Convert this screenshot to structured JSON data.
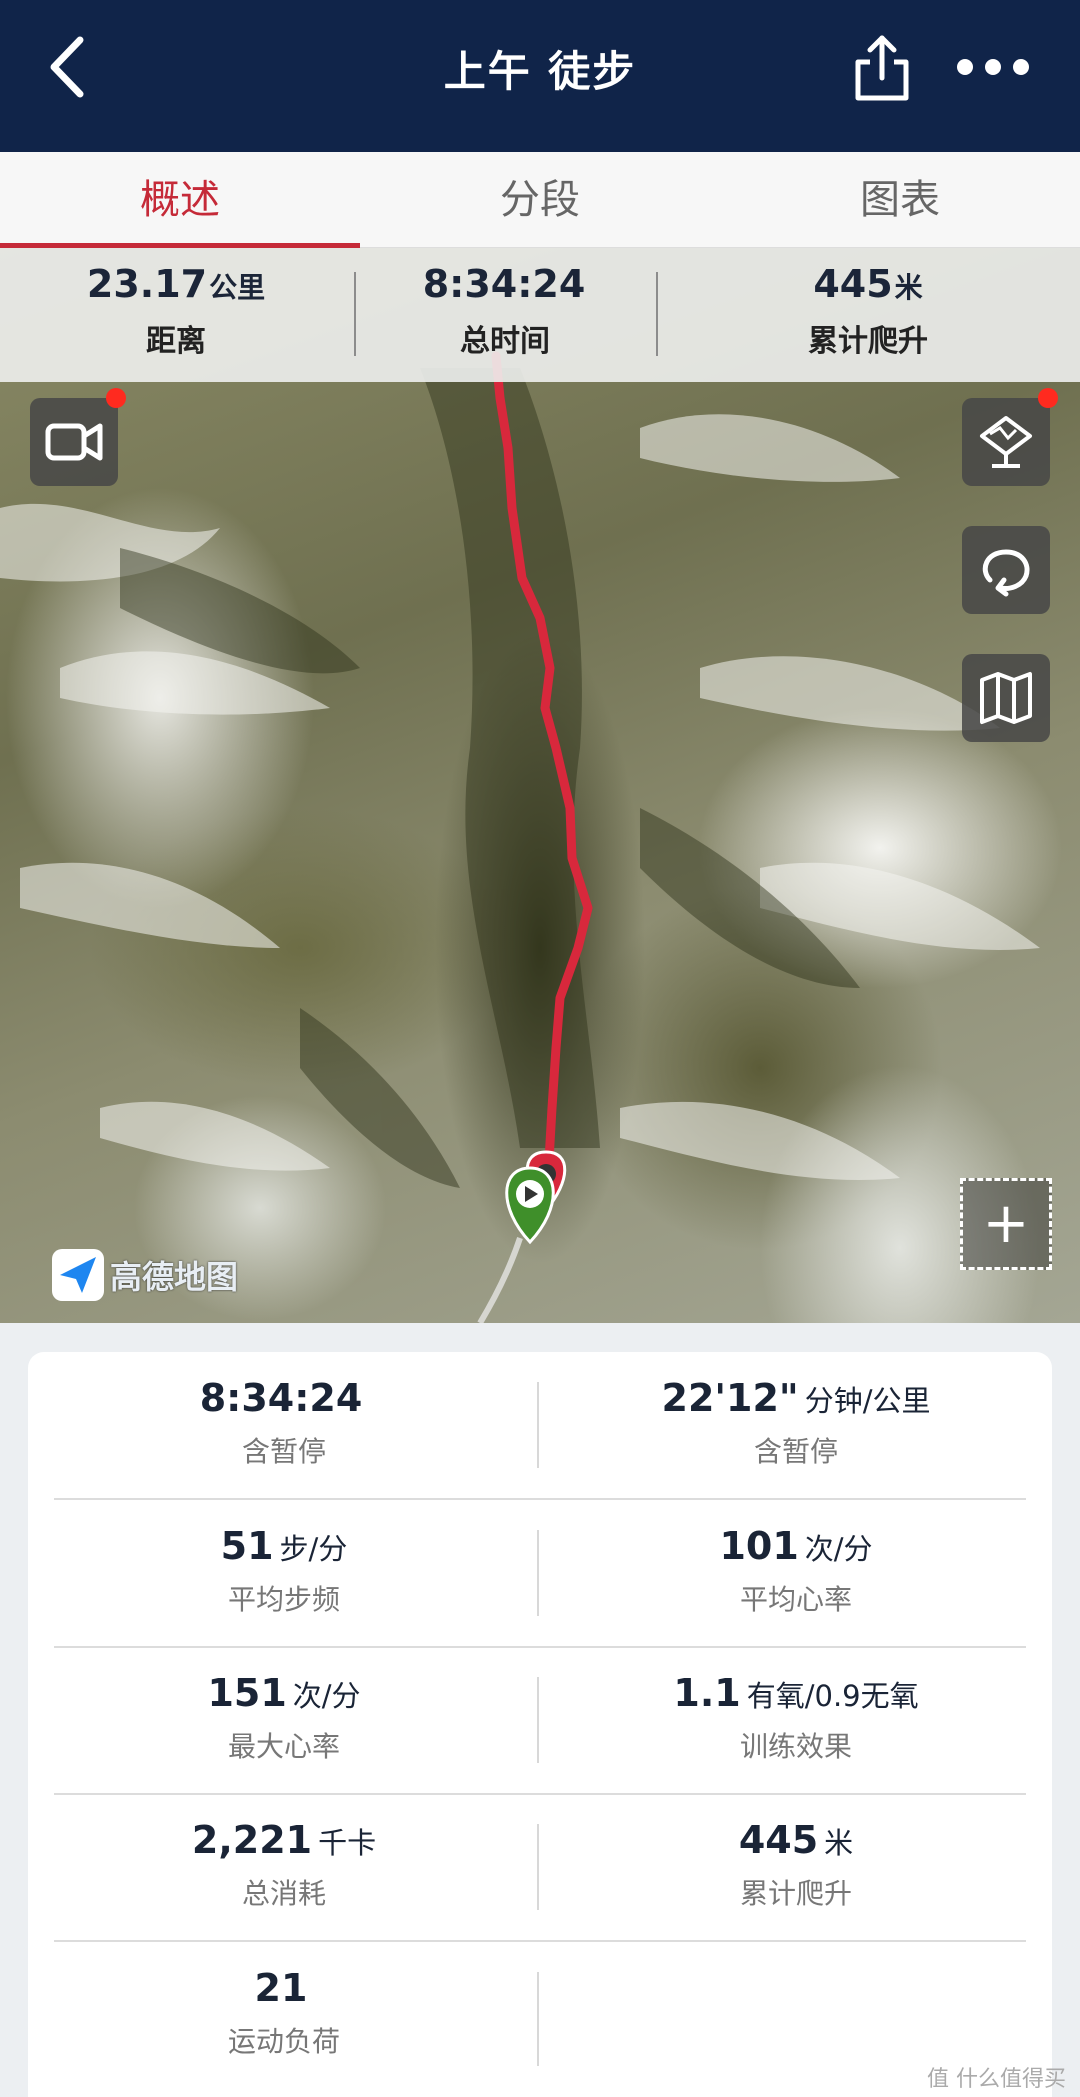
{
  "header": {
    "title": "上午 徒步"
  },
  "tabs": [
    {
      "label": "概述",
      "active": true
    },
    {
      "label": "分段",
      "active": false
    },
    {
      "label": "图表",
      "active": false
    }
  ],
  "summary": {
    "distance": {
      "value": "23.17",
      "unit": "公里",
      "label": "距离"
    },
    "time": {
      "value": "8:34:24",
      "unit": "",
      "label": "总时间"
    },
    "ascent": {
      "value": "445",
      "unit": "米",
      "label": "累计爬升"
    }
  },
  "map": {
    "provider": "高德地图",
    "zoom_label": "+",
    "buttons": [
      "video-icon",
      "terrain-3d-icon",
      "replay-icon",
      "map-layers-icon"
    ]
  },
  "details": [
    {
      "value": "8:34:24",
      "unit": "",
      "label": "含暂停"
    },
    {
      "value": "22'12\"",
      "unit": "分钟/公里",
      "label": "含暂停"
    },
    {
      "value": "51",
      "unit": "步/分",
      "label": "平均步频"
    },
    {
      "value": "101",
      "unit": "次/分",
      "label": "平均心率"
    },
    {
      "value": "151",
      "unit": "次/分",
      "label": "最大心率"
    },
    {
      "value": "1.1",
      "unit": "有氧/0.9无氧",
      "label": "训练效果"
    },
    {
      "value": "2,221",
      "unit": "千卡",
      "label": "总消耗"
    },
    {
      "value": "445",
      "unit": "米",
      "label": "累计爬升"
    },
    {
      "value": "21",
      "unit": "",
      "label": "运动负荷"
    }
  ],
  "watermark": "值 什么值得买",
  "colors": {
    "header_bg": "#102449",
    "accent": "#c52a38",
    "route": "#d8283c",
    "start_pin": "#3f8f2a"
  }
}
